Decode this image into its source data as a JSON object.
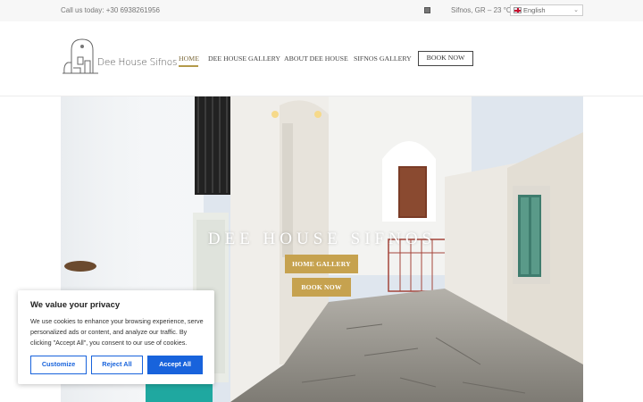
{
  "topbar": {
    "phone_text": "Call us today: +30 6938261956",
    "weather_icon": "weather-icon",
    "weather_text": "Sifnos, GR – 23 °C",
    "language": "English"
  },
  "header": {
    "logo_text": "Dee House Sifnos",
    "nav": [
      "HOME",
      "DEE HOUSE GALLERY",
      "ABOUT DEE HOUSE",
      "SIFNOS GALLERY"
    ],
    "book_label": "BOOK NOW"
  },
  "hero": {
    "title": "DEE HOUSE SIFNOS",
    "gallery_button": "HOME GALLERY",
    "book_button": "BOOK NOW"
  },
  "cookie": {
    "title": "We value your privacy",
    "body": "We use cookies to enhance your browsing experience, serve personalized ads or content, and analyze our traffic. By clicking \"Accept All\", you consent to our use of cookies.",
    "customize": "Customize",
    "reject": "Reject All",
    "accept": "Accept All"
  },
  "colors": {
    "accent_gold": "#c6a24f",
    "cookie_blue": "#1863dc"
  }
}
